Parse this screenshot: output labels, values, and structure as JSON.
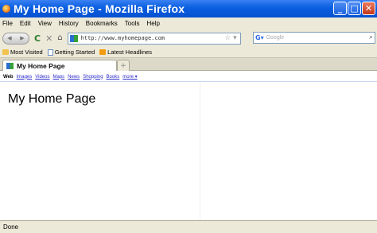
{
  "window": {
    "title": "My Home Page - Mozilla Firefox",
    "buttons": {
      "minimize": "_",
      "maximize": "□",
      "close": "✕"
    }
  },
  "menu": [
    "File",
    "Edit",
    "View",
    "History",
    "Bookmarks",
    "Tools",
    "Help"
  ],
  "nav": {
    "url": "http://www.myhomepage.com",
    "search_placeholder": "Google"
  },
  "bookmarks": [
    "Most Visited",
    "Getting Started",
    "Latest Headlines"
  ],
  "tabs": [
    {
      "label": "My Home Page"
    }
  ],
  "google_bar": [
    "Web",
    "Images",
    "Videos",
    "Maps",
    "News",
    "Shopping",
    "Books",
    "more ▾"
  ],
  "page": {
    "heading": "My Home Page"
  },
  "status": "Done"
}
